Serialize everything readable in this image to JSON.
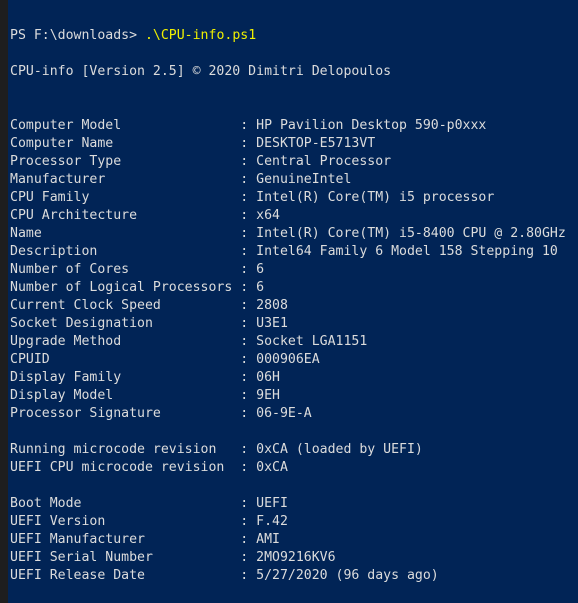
{
  "window": {
    "background": "#012456",
    "text_color": "#dcdcdc",
    "command_color": "#f0f000"
  },
  "prompt": {
    "path": "PS F:\\downloads> ",
    "command": ".\\CPU-info.ps1"
  },
  "banner": "CPU-info [Version 2.5] © 2020 Dimitri Delopoulos",
  "sections": [
    [
      {
        "label": "Computer Model",
        "value": "HP Pavilion Desktop 590-p0xxx"
      },
      {
        "label": "Computer Name",
        "value": "DESKTOP-E5713VT"
      },
      {
        "label": "Processor Type",
        "value": "Central Processor"
      },
      {
        "label": "Manufacturer",
        "value": "GenuineIntel"
      },
      {
        "label": "CPU Family",
        "value": "Intel(R) Core(TM) i5 processor"
      },
      {
        "label": "CPU Architecture",
        "value": "x64"
      },
      {
        "label": "Name",
        "value": "Intel(R) Core(TM) i5-8400 CPU @ 2.80GHz"
      },
      {
        "label": "Description",
        "value": "Intel64 Family 6 Model 158 Stepping 10"
      },
      {
        "label": "Number of Cores",
        "value": "6"
      },
      {
        "label": "Number of Logical Processors",
        "value": "6"
      },
      {
        "label": "Current Clock Speed",
        "value": "2808"
      },
      {
        "label": "Socket Designation",
        "value": "U3E1"
      },
      {
        "label": "Upgrade Method",
        "value": "Socket LGA1151"
      },
      {
        "label": "CPUID",
        "value": "000906EA"
      },
      {
        "label": "Display Family",
        "value": "06H"
      },
      {
        "label": "Display Model",
        "value": "9EH"
      },
      {
        "label": "Processor Signature",
        "value": "06-9E-A"
      }
    ],
    [
      {
        "label": "Running microcode revision",
        "value": "0xCA (loaded by UEFI)"
      },
      {
        "label": "UEFI CPU microcode revision",
        "value": "0xCA"
      }
    ],
    [
      {
        "label": "Boot Mode",
        "value": "UEFI"
      },
      {
        "label": "UEFI Version",
        "value": "F.42"
      },
      {
        "label": "UEFI Manufacturer",
        "value": "AMI"
      },
      {
        "label": "UEFI Serial Number",
        "value": "2MO9216KV6"
      },
      {
        "label": "UEFI Release Date",
        "value": "5/27/2020 (96 days ago)"
      }
    ]
  ]
}
